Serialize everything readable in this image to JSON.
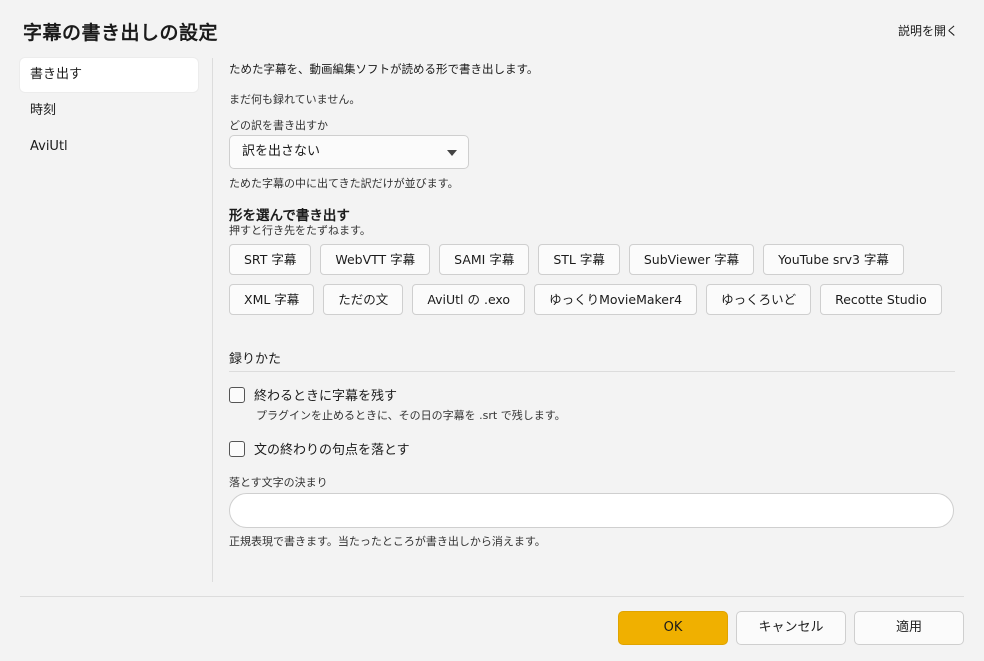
{
  "header": {
    "title": "字幕の書き出しの設定",
    "help_label": "説明を開く"
  },
  "sidebar": {
    "items": [
      {
        "label": "書き出す",
        "active": true
      },
      {
        "label": "時刻",
        "active": false
      },
      {
        "label": "AviUtl",
        "active": false
      }
    ]
  },
  "main": {
    "intro": "ためた字幕を、動画編集ソフトが読める形で書き出します。",
    "status": "まだ何も録れていません。",
    "translation": {
      "label": "どの訳を書き出すか",
      "selected": "訳を出さない",
      "hint": "ためた字幕の中に出てきた訳だけが並びます。"
    },
    "format": {
      "title": "形を選んで書き出す",
      "hint": "押すと行き先をたずねます。",
      "buttons_row1": [
        "SRT 字幕",
        "WebVTT 字幕",
        "SAMI 字幕",
        "STL 字幕",
        "SubViewer 字幕",
        "YouTube srv3 字幕"
      ],
      "buttons_row2": [
        "XML 字幕",
        "ただの文",
        "AviUtl の .exo",
        "ゆっくりMovieMaker4",
        "ゆっくろいど",
        "Recotte Studio"
      ]
    },
    "recording": {
      "title": "録りかた",
      "keep_on_exit": {
        "label": "終わるときに字幕を残す",
        "hint": "プラグインを止めるときに、その日の字幕を .srt で残します。",
        "checked": false
      },
      "drop_period": {
        "label": "文の終わりの句点を落とす",
        "checked": false
      },
      "pattern": {
        "label": "落とす文字の決まり",
        "value": "",
        "placeholder": "",
        "hint": "正規表現で書きます。当たったところが書き出しから消えます。"
      }
    }
  },
  "footer": {
    "ok_label": "OK",
    "cancel_label": "キャンセル",
    "apply_label": "適用"
  },
  "colors": {
    "accent": "#f0b000",
    "background": "#f3f3f3"
  }
}
